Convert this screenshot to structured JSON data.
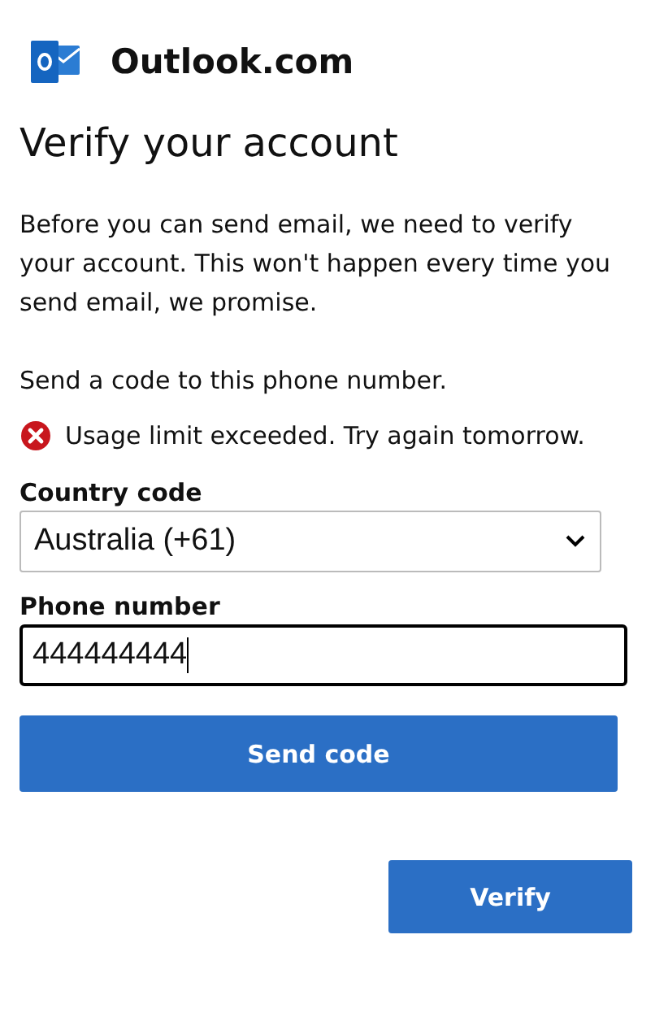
{
  "header": {
    "brand": "Outlook.com"
  },
  "title": "Verify your account",
  "intro": "Before you can send email, we need to verify your account. This won't happen every time you send email, we promise.",
  "prompt": "Send a code to this phone number.",
  "error": {
    "message": "Usage limit exceeded. Try again tomorrow."
  },
  "fields": [
    {
      "kind": "select",
      "label": "Country code",
      "value": "Australia (+61)",
      "focused": false
    },
    {
      "kind": "text",
      "label": "Phone number",
      "value": "444444444",
      "focused": true
    }
  ],
  "send_button": "Send code",
  "verify_button": "Verify"
}
